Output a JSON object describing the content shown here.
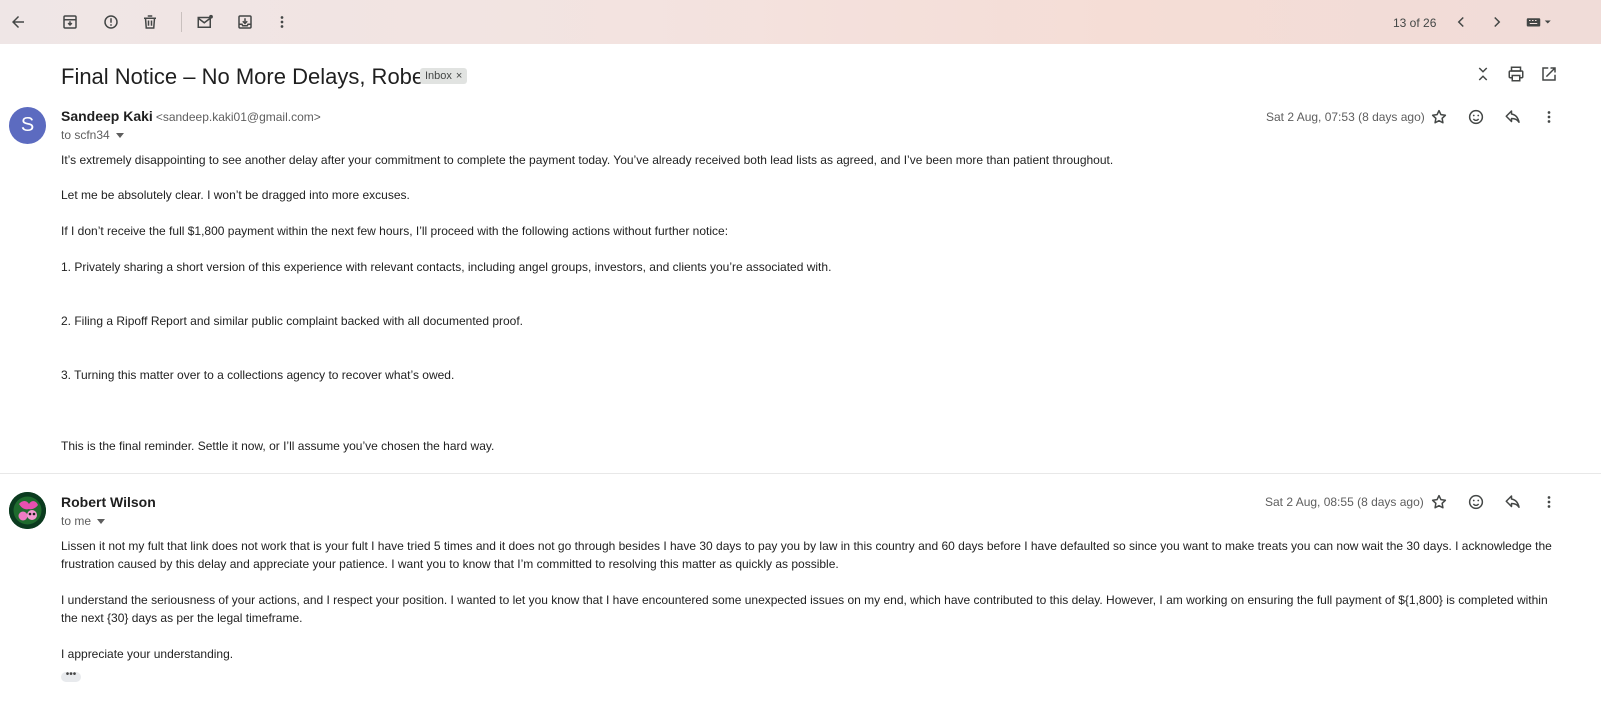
{
  "toolbar": {
    "page_count": "13 of 26",
    "icons": [
      "back-arrow-icon",
      "archive-icon",
      "report-spam-icon",
      "delete-icon",
      "mark-unread-icon",
      "move-to-icon",
      "more-vert-icon",
      "chevron-left-icon",
      "chevron-right-icon",
      "keyboard-icon"
    ]
  },
  "subject": {
    "title": "Final Notice – No More Delays, Robert",
    "label": "Inbox",
    "label_remove": "×"
  },
  "messages": [
    {
      "avatar_letter": "S",
      "sender_name": "Sandeep Kaki",
      "sender_email": "<sandeep.kaki01@gmail.com>",
      "to": "to scfn34",
      "date": "Sat 2 Aug, 07:53 (8 days ago)",
      "paragraphs": [
        "It’s extremely disappointing to see another delay after your commitment to complete the payment today. You’ve already received both lead lists as agreed, and I’ve been more than patient throughout.",
        "Let me be absolutely clear. I won’t be dragged into more excuses.",
        "If I don’t receive the full $1,800 payment within the next few hours, I’ll proceed with the following actions without further notice:",
        "1. Privately sharing a short version of this experience with relevant contacts, including angel groups, investors, and clients you’re associated with.",
        "2. Filing a Ripoff Report and similar public complaint backed with all documented proof.",
        "3. Turning this matter over to a collections agency to recover what’s owed.",
        "This is the final reminder. Settle it now, or I’ll assume you’ve chosen the hard way."
      ]
    },
    {
      "sender_name": "Robert Wilson",
      "to": "to me",
      "date": "Sat 2 Aug, 08:55 (8 days ago)",
      "paragraphs": [
        "Lissen it not my fult that link does not work that is your fult I have tried 5 times and it does not go through besides I have 30 days to pay you by law in this country and 60 days before I have defaulted so since you want to make treats you can now wait the 30 days. I acknowledge the frustration caused by this delay and appreciate your patience. I want you to know that I’m committed to resolving this matter as quickly as possible.",
        "I understand the seriousness of your actions, and I respect your position. I wanted to let you know that I have encountered some unexpected issues on my end, which have contributed to this delay. However, I am working on ensuring the full payment of ${1,800} is completed within the next {30} days as per the legal timeframe.",
        "I appreciate your understanding."
      ],
      "trimmed": "•••"
    }
  ]
}
